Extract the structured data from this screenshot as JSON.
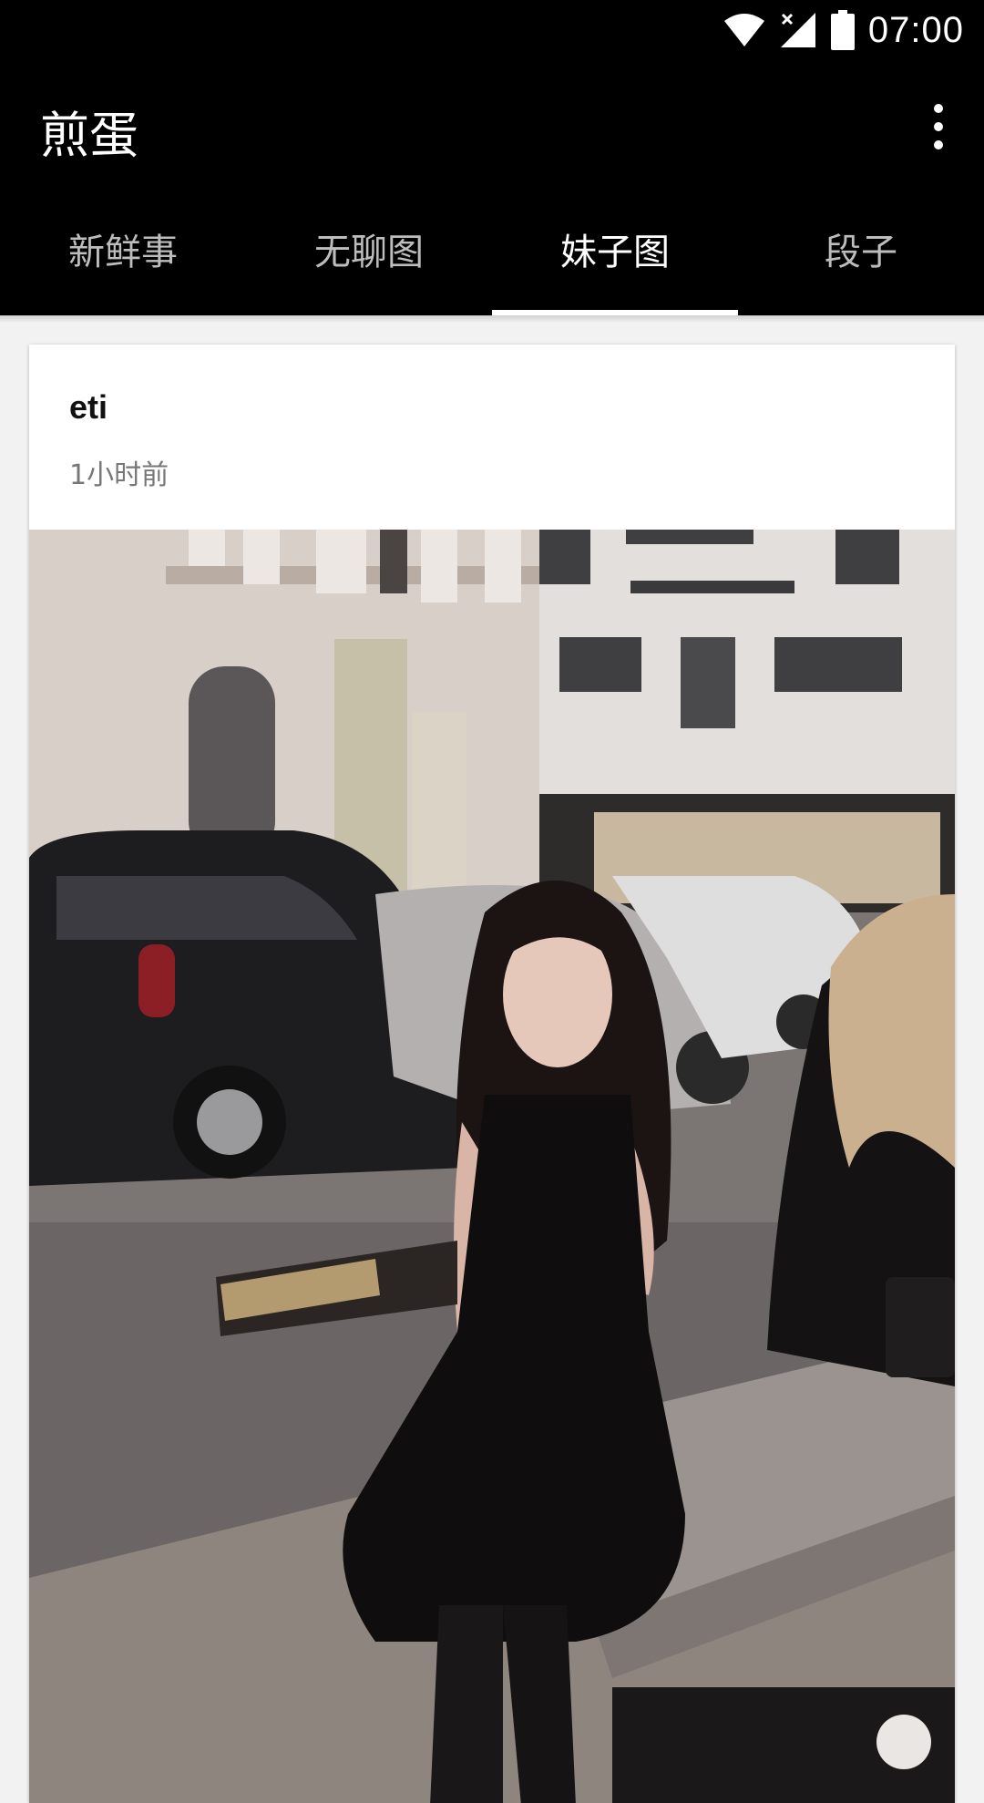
{
  "status_bar": {
    "time": "07:00",
    "icons": [
      "wifi-icon",
      "cellular-no-signal-icon",
      "battery-icon"
    ]
  },
  "toolbar": {
    "title": "煎蛋",
    "overflow_icon": "more-vert-icon"
  },
  "tabs": [
    {
      "label": "新鲜事",
      "active": false
    },
    {
      "label": "无聊图",
      "active": false
    },
    {
      "label": "妹子图",
      "active": true
    },
    {
      "label": "段子",
      "active": false
    }
  ],
  "post": {
    "author": "eti",
    "time": "1小时前",
    "image_alt": "street-photo"
  },
  "colors": {
    "bar_background": "#000000",
    "tab_inactive": "#bdbdbd",
    "tab_active": "#ffffff",
    "page_background": "#f2f2f2",
    "card_background": "#ffffff"
  }
}
